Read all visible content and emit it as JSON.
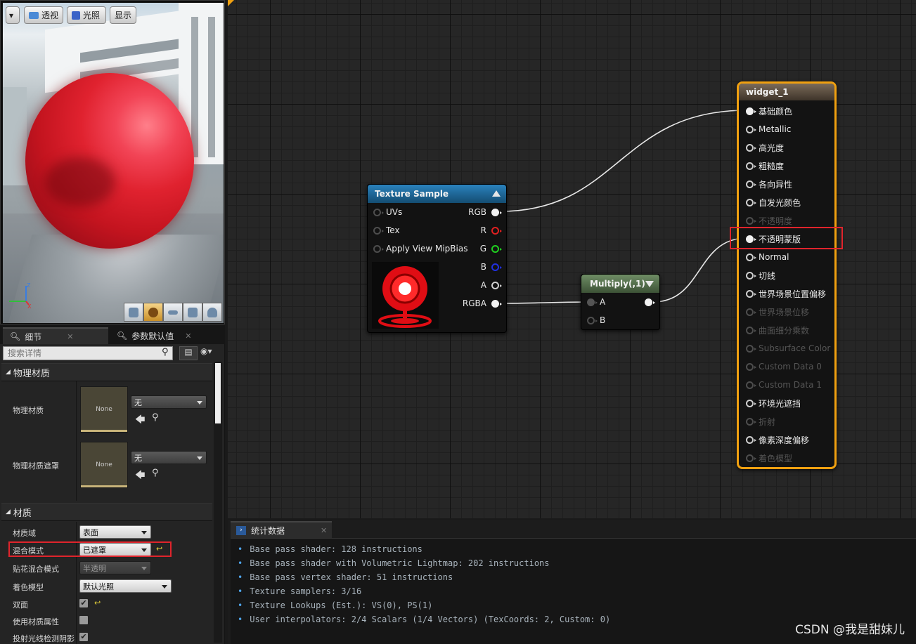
{
  "viewport": {
    "buttons": {
      "dropdown": "▾",
      "perspective": "透视",
      "lit": "光照",
      "show": "显示"
    },
    "axes": {
      "x": "X",
      "y": "Y",
      "z": "Z"
    }
  },
  "details": {
    "tabs": [
      {
        "label": "细节"
      },
      {
        "label": "参数默认值"
      }
    ],
    "search_placeholder": "搜索详情",
    "sections": {
      "physical_material": {
        "title": "物理材质",
        "rows": [
          {
            "label": "物理材质",
            "thumb": "None",
            "value": "无"
          },
          {
            "label": "物理材质遮罩",
            "thumb": "None",
            "value": "无"
          }
        ]
      },
      "material": {
        "title": "材质",
        "rows": [
          {
            "label": "材质域",
            "value": "表面"
          },
          {
            "label": "混合模式",
            "value": "已遮罩"
          },
          {
            "label": "贴花混合模式",
            "value": "半透明"
          },
          {
            "label": "着色模型",
            "value": "默认光照"
          },
          {
            "label": "双面",
            "checked": true
          },
          {
            "label": "使用材质属性",
            "checked": false
          },
          {
            "label": "投射光线检测阴影",
            "checked": true
          }
        ]
      }
    }
  },
  "graph": {
    "texture_sample": {
      "title": "Texture Sample",
      "inputs": [
        "UVs",
        "Tex",
        "Apply View MipBias"
      ],
      "outputs": [
        "RGB",
        "R",
        "G",
        "B",
        "A",
        "RGBA"
      ]
    },
    "multiply": {
      "title": "Multiply(,1)",
      "inputs": [
        "A",
        "B"
      ]
    },
    "widget": {
      "title": "widget_1",
      "pins": [
        {
          "label": "基础颜色",
          "connected": true,
          "enabled": true
        },
        {
          "label": "Metallic",
          "connected": false,
          "enabled": true
        },
        {
          "label": "高光度",
          "connected": false,
          "enabled": true
        },
        {
          "label": "粗糙度",
          "connected": false,
          "enabled": true
        },
        {
          "label": "各向异性",
          "connected": false,
          "enabled": true
        },
        {
          "label": "自发光颜色",
          "connected": false,
          "enabled": true
        },
        {
          "label": "不透明度",
          "connected": false,
          "enabled": false
        },
        {
          "label": "不透明蒙版",
          "connected": true,
          "enabled": true
        },
        {
          "label": "Normal",
          "connected": false,
          "enabled": true
        },
        {
          "label": "切线",
          "connected": false,
          "enabled": true
        },
        {
          "label": "世界场景位置偏移",
          "connected": false,
          "enabled": true
        },
        {
          "label": "世界场景位移",
          "connected": false,
          "enabled": false
        },
        {
          "label": "曲面细分乘数",
          "connected": false,
          "enabled": false
        },
        {
          "label": "Subsurface Color",
          "connected": false,
          "enabled": false
        },
        {
          "label": "Custom Data 0",
          "connected": false,
          "enabled": false
        },
        {
          "label": "Custom Data 1",
          "connected": false,
          "enabled": false
        },
        {
          "label": "环境光遮挡",
          "connected": false,
          "enabled": true
        },
        {
          "label": "折射",
          "connected": false,
          "enabled": false
        },
        {
          "label": "像素深度偏移",
          "connected": false,
          "enabled": true
        },
        {
          "label": "着色模型",
          "connected": false,
          "enabled": false
        }
      ]
    }
  },
  "stats": {
    "tab_label": "统计数据",
    "lines": [
      "Base pass shader: 128 instructions",
      "Base pass shader with Volumetric Lightmap: 202 instructions",
      "Base pass vertex shader: 51 instructions",
      "Texture samplers: 3/16",
      "Texture Lookups (Est.): VS(0), PS(1)",
      "User interpolators: 2/4 Scalars (1/4 Vectors) (TexCoords: 2, Custom: 0)"
    ]
  },
  "watermark": "CSDN @我是甜妹儿",
  "colors": {
    "highlight_box": "#e0242c",
    "selected_node_border": "#f0a010",
    "texture_header": "#1f6a9c",
    "multiply_header": "#55704d",
    "widget_header": "#5b4d3f"
  }
}
